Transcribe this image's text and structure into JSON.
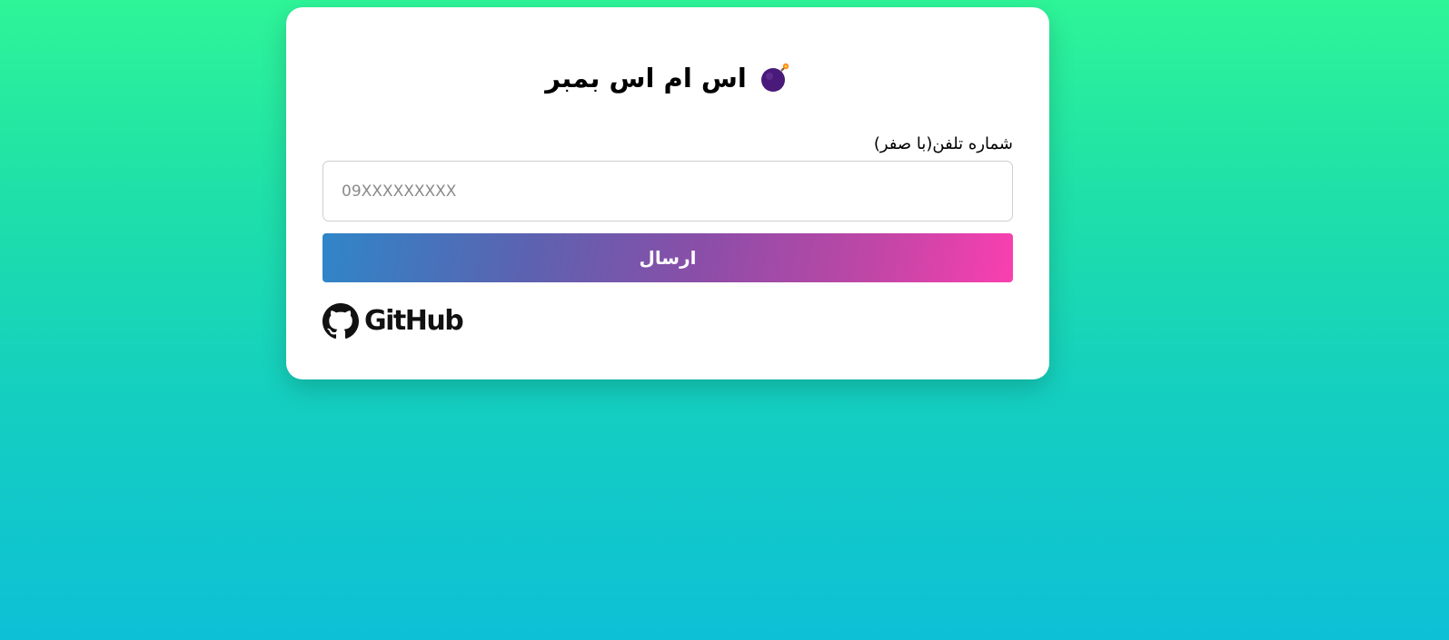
{
  "app": {
    "title": "اس ام اس بمبر",
    "icon": "bomb-icon"
  },
  "form": {
    "phone_label": "شماره تلفن(با صفر)",
    "phone_placeholder": "09XXXXXXXXX",
    "phone_value": "",
    "submit_label": "ارسال"
  },
  "footer": {
    "github_label": "GitHub",
    "github_icon": "github-icon"
  },
  "colors": {
    "background_top": "#2ef598",
    "background_bottom": "#0ec0d6",
    "button_gradient_start": "#2f86c8",
    "button_gradient_end": "#fa3fb0",
    "card_background": "#ffffff"
  }
}
